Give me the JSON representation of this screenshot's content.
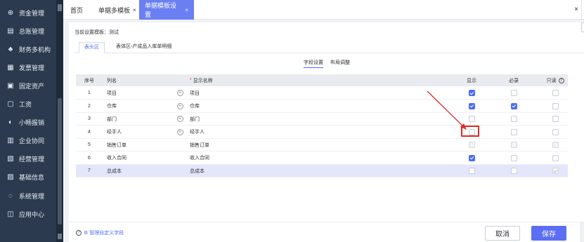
{
  "sidebar": {
    "items": [
      {
        "label": "资金管理",
        "icon": "fund-icon",
        "glyph": "⊕"
      },
      {
        "label": "总账管理",
        "icon": "ledger-icon",
        "glyph": "▤"
      },
      {
        "label": "财务多机构",
        "icon": "org-icon",
        "glyph": "♣"
      },
      {
        "label": "发票管理",
        "icon": "invoice-icon",
        "glyph": "▦"
      },
      {
        "label": "固定资产",
        "icon": "asset-icon",
        "glyph": "▣"
      },
      {
        "label": "工资",
        "icon": "salary-icon",
        "glyph": "▢"
      },
      {
        "label": "小畅报销",
        "icon": "reimburse-icon",
        "glyph": "◐"
      },
      {
        "label": "企业协同",
        "icon": "collab-icon",
        "glyph": "▥"
      },
      {
        "label": "经营管理",
        "icon": "operation-icon",
        "glyph": "▧"
      },
      {
        "label": "基础信息",
        "icon": "basic-info-icon",
        "glyph": "▨"
      },
      {
        "label": "系统管理",
        "icon": "system-icon",
        "glyph": "◌"
      },
      {
        "label": "应用中心",
        "icon": "app-center-icon",
        "glyph": "◫"
      }
    ]
  },
  "tabs": [
    {
      "label": "首页"
    },
    {
      "label": "单据多模板",
      "close": "×"
    },
    {
      "label": "单据模板设置",
      "close": "×"
    }
  ],
  "topbar": {
    "close_all": "×"
  },
  "main": {
    "current_template": "当前设置模板：测试",
    "subtabs": [
      "表头区",
      "表体区-产成品入库单明细"
    ],
    "segments": [
      "字段设置",
      "布局调整"
    ]
  },
  "table": {
    "headers": {
      "index": "序号",
      "column": "列名",
      "display_name": "显示名称",
      "show": "显示",
      "required": "必录",
      "readonly": "只读",
      "required_mark": "*",
      "help": "?"
    },
    "rows": [
      {
        "index": "1",
        "column": "项目",
        "display_name": "项目",
        "has_plus": true,
        "show": "on",
        "required": "off",
        "readonly": "off"
      },
      {
        "index": "2",
        "column": "仓库",
        "display_name": "仓库",
        "has_plus": true,
        "show": "on",
        "required": "on",
        "readonly": "off"
      },
      {
        "index": "3",
        "column": "部门",
        "display_name": "部门",
        "has_plus": true,
        "show": "off",
        "required": "off",
        "readonly": "off"
      },
      {
        "index": "4",
        "column": "经手人",
        "display_name": "经手人",
        "has_plus": true,
        "show": "off",
        "required": "off",
        "readonly": "off"
      },
      {
        "index": "5",
        "column": "销售订单",
        "display_name": "销售订单",
        "has_plus": false,
        "show": "dis",
        "required": "dis",
        "readonly": "dis"
      },
      {
        "index": "6",
        "column": "收入合同",
        "display_name": "收入合同",
        "has_plus": false,
        "show": "on",
        "required": "off",
        "readonly": "off"
      },
      {
        "index": "7",
        "column": "总成本",
        "display_name": "总成本",
        "has_plus": false,
        "show": "off",
        "required": "off",
        "readonly": "dis-on",
        "selected": true
      }
    ]
  },
  "footer": {
    "custom_fields_link": "管理自定义字段",
    "help_glyph": "?",
    "cancel_label": "取消",
    "save_label": "保存"
  },
  "annotation": {
    "color": "#e02a2a"
  },
  "colors": {
    "accent": "#4a6cf7",
    "sidebar_bg": "#2b3a4f",
    "active_tab": "#6a7ff2",
    "save_button": "#5b6ef5"
  }
}
